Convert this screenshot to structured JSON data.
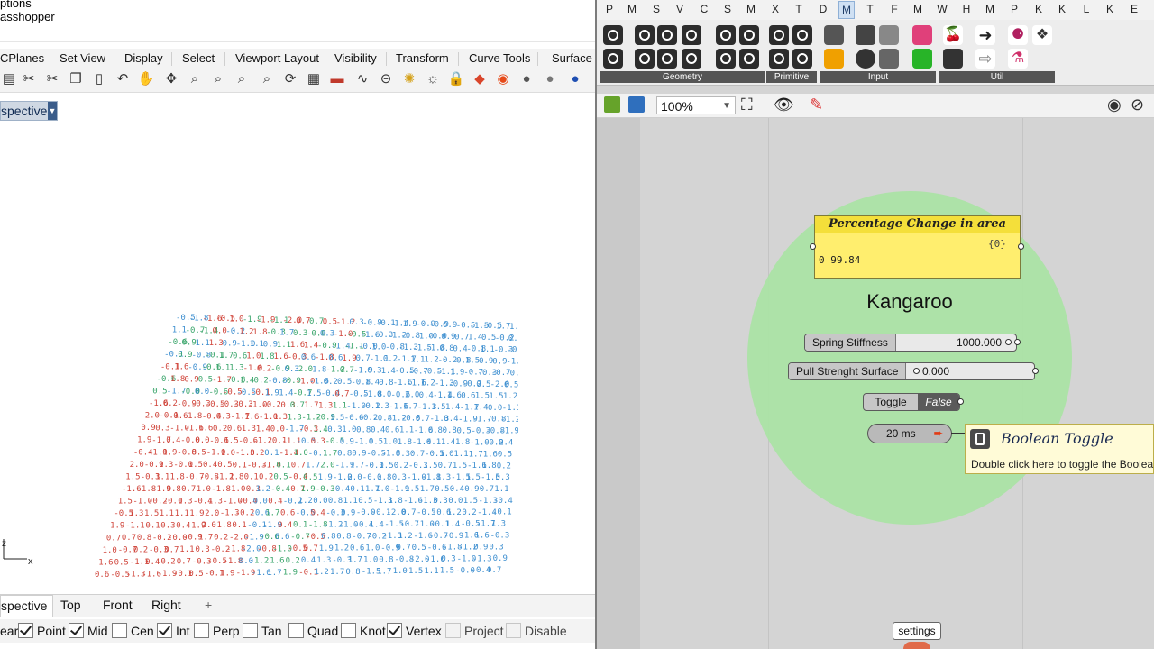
{
  "rhino": {
    "title_lines": [
      "ptions",
      "asshopper"
    ],
    "ribbon_tabs": [
      "CPlanes",
      "Set View",
      "Display",
      "Select",
      "Viewport Layout",
      "Visibility",
      "Transform",
      "Curve Tools",
      "Surface T"
    ],
    "toolbar_icons": [
      "save-icon",
      "cut-icon",
      "copy-icon",
      "paste-icon",
      "undo-icon",
      "pan-icon",
      "move-icon",
      "zoom-icon",
      "zoom-window-icon",
      "zoom-extents-icon",
      "zoom-selected-icon",
      "rotate-view-icon",
      "grid-icon",
      "car-icon",
      "curve-icon",
      "wireframe-icon",
      "light-icon",
      "lock-icon",
      "shield-icon",
      "color-wheel-icon",
      "shaded-icon",
      "rendered-icon",
      "sphere-icon"
    ],
    "viewport_name": "spective",
    "viewport_tabs": [
      {
        "label": "spective",
        "active": true
      },
      {
        "label": "Top",
        "active": false
      },
      {
        "label": "Front",
        "active": false
      },
      {
        "label": "Right",
        "active": false
      },
      {
        "label": "+",
        "active": false
      }
    ],
    "axis_labels": {
      "x": "x",
      "z": "z"
    },
    "osnaps": [
      {
        "label": "ear",
        "checked": null,
        "enabled": true
      },
      {
        "label": "Point",
        "checked": true,
        "enabled": true
      },
      {
        "label": "Mid",
        "checked": true,
        "enabled": true
      },
      {
        "label": "Cen",
        "checked": false,
        "enabled": true
      },
      {
        "label": "Int",
        "checked": true,
        "enabled": true
      },
      {
        "label": "Perp",
        "checked": false,
        "enabled": true
      },
      {
        "label": "Tan",
        "checked": false,
        "enabled": true
      },
      {
        "label": "Quad",
        "checked": false,
        "enabled": true
      },
      {
        "label": "Knot",
        "checked": false,
        "enabled": true
      },
      {
        "label": "Vertex",
        "checked": true,
        "enabled": true
      },
      {
        "label": "Project",
        "checked": false,
        "enabled": false
      },
      {
        "label": "Disable",
        "checked": false,
        "enabled": false
      }
    ]
  },
  "grasshopper": {
    "tab_letters": [
      "P",
      "M",
      "S",
      "V",
      "C",
      "S",
      "M",
      "X",
      "T",
      "D",
      "M",
      "T",
      "F",
      "M",
      "W",
      "H",
      "M",
      "P",
      "K",
      "K",
      "L",
      "K",
      "E"
    ],
    "active_tab_index": 10,
    "ribbon_panels": [
      {
        "label": "Geometry"
      },
      {
        "label": "Primitive"
      },
      {
        "label": "Input"
      },
      {
        "label": "Util"
      }
    ],
    "zoom": "100%",
    "panel_title": "Percentage Change in area",
    "panel_path": "{0}",
    "panel_value_index": "0",
    "panel_value": "99.84",
    "group_name": "Kangaroo",
    "spring_slider": {
      "label": "Spring Stiffness",
      "value": "1000.000"
    },
    "pull_slider": {
      "label": "Pull Strenght Surface",
      "value": "0.000"
    },
    "toggle": {
      "label": "Toggle",
      "value": "False"
    },
    "timer": {
      "label": "20 ms"
    },
    "tooltip": {
      "title": "Boolean Toggle",
      "description": "Double click here to toggle the Boolea"
    },
    "settings_label": "settings",
    "colors": {
      "group_fill": "#a9e3a4",
      "panel_yellow": "#ffee6e",
      "timer_arrow": "#e23b14"
    }
  }
}
